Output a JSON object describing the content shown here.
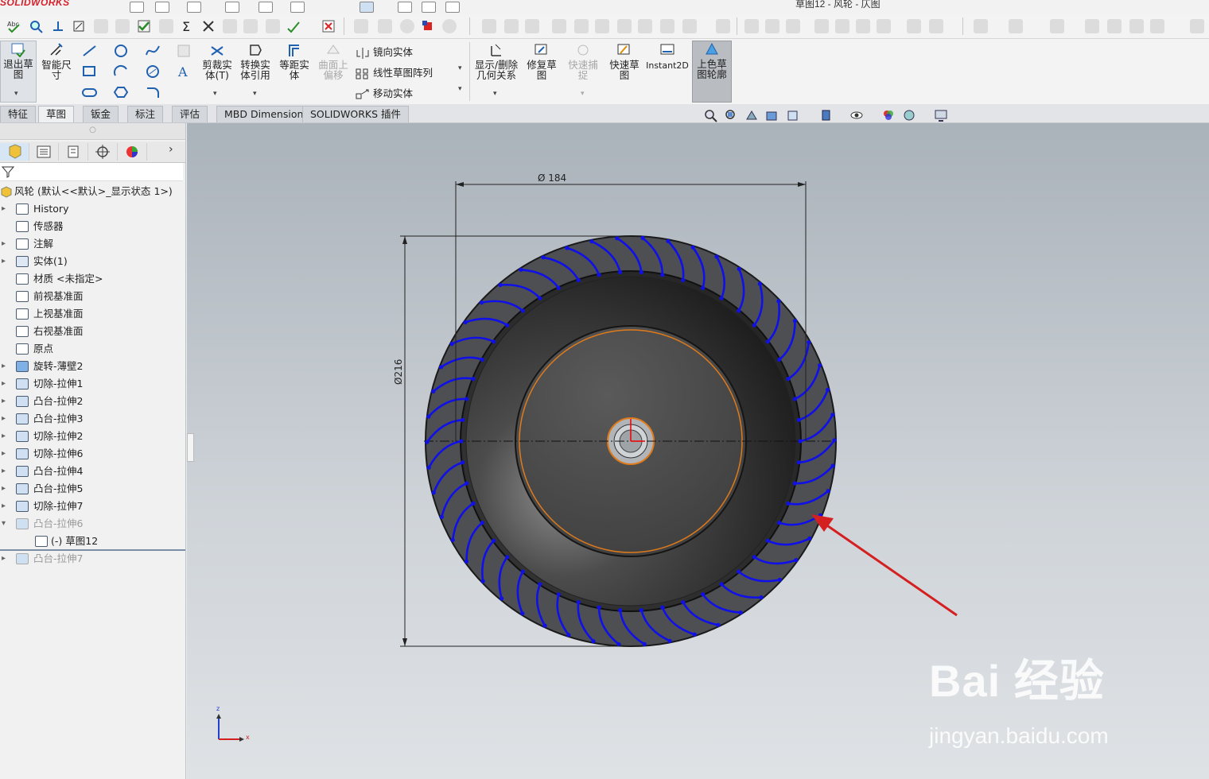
{
  "app": {
    "logo_text": "SOLIDWORKS",
    "doc_title": "草图12 - 风轮 - 仄图"
  },
  "command_manager": {
    "exit_sketch": "退出草\n图",
    "smart_dim": "智能尺\n寸",
    "trim": "剪裁实\n体(T)",
    "convert": "转换实\n体引用",
    "offset": "等距实\n体",
    "surface_offset": "曲面上\n偏移",
    "mirror": "镜向实体",
    "linear_pattern": "线性草图阵列",
    "move": "移动实体",
    "show_relations": "显示/删除\n几何关系",
    "repair": "修复草\n图",
    "quick_snaps": "快速捕\n捉",
    "rapid_sketch": "快速草\n图",
    "instant2d": "Instant2D",
    "shaded_contours": "上色草\n图轮廓"
  },
  "tabs": [
    "特征",
    "草图",
    "钣金",
    "标注",
    "评估",
    "MBD Dimensions",
    "SOLIDWORKS 插件"
  ],
  "active_tab": "草图",
  "tree": {
    "root": "风轮  (默认<<默认>_显示状态 1>)",
    "items": [
      {
        "label": "History",
        "icon": "history-icon",
        "arrow": "▸"
      },
      {
        "label": "传感器",
        "icon": "sensor-icon",
        "arrow": ""
      },
      {
        "label": "注解",
        "icon": "annotation-icon",
        "arrow": "▸"
      },
      {
        "label": "实体(1)",
        "icon": "solid-bodies-icon",
        "arrow": "▸"
      },
      {
        "label": "材质 <未指定>",
        "icon": "material-icon",
        "arrow": ""
      },
      {
        "label": "前视基准面",
        "icon": "plane-icon",
        "arrow": ""
      },
      {
        "label": "上视基准面",
        "icon": "plane-icon",
        "arrow": ""
      },
      {
        "label": "右视基准面",
        "icon": "plane-icon",
        "arrow": ""
      },
      {
        "label": "原点",
        "icon": "origin-icon",
        "arrow": ""
      },
      {
        "label": "旋转-薄壁2",
        "icon": "revolve-icon",
        "arrow": "▸"
      },
      {
        "label": "切除-拉伸1",
        "icon": "cut-extrude-icon",
        "arrow": "▸"
      },
      {
        "label": "凸台-拉伸2",
        "icon": "boss-extrude-icon",
        "arrow": "▸"
      },
      {
        "label": "凸台-拉伸3",
        "icon": "boss-extrude-icon",
        "arrow": "▸"
      },
      {
        "label": "切除-拉伸2",
        "icon": "cut-extrude-icon",
        "arrow": "▸"
      },
      {
        "label": "切除-拉伸6",
        "icon": "cut-extrude-icon",
        "arrow": "▸"
      },
      {
        "label": "凸台-拉伸4",
        "icon": "boss-extrude-icon",
        "arrow": "▸"
      },
      {
        "label": "凸台-拉伸5",
        "icon": "boss-extrude-icon",
        "arrow": "▸"
      },
      {
        "label": "切除-拉伸7",
        "icon": "cut-extrude-icon",
        "arrow": "▸"
      },
      {
        "label": "凸台-拉伸6",
        "icon": "boss-extrude-icon",
        "arrow": "▾",
        "dim": true
      },
      {
        "label": "(-) 草图12",
        "icon": "sketch-icon",
        "arrow": "",
        "sub": true
      },
      {
        "label": "凸台-拉伸7",
        "icon": "boss-extrude-icon",
        "arrow": "▸",
        "dim": true
      }
    ]
  },
  "drawing": {
    "dim_horizontal": "Ø 184",
    "dim_vertical": "Ø216",
    "axis_z": "z",
    "axis_x": "x",
    "blade_color": "#1010e8",
    "arrow_color": "#d42020"
  },
  "watermark": {
    "brand": "Bai 经验",
    "url": "jingyan.baidu.com"
  }
}
